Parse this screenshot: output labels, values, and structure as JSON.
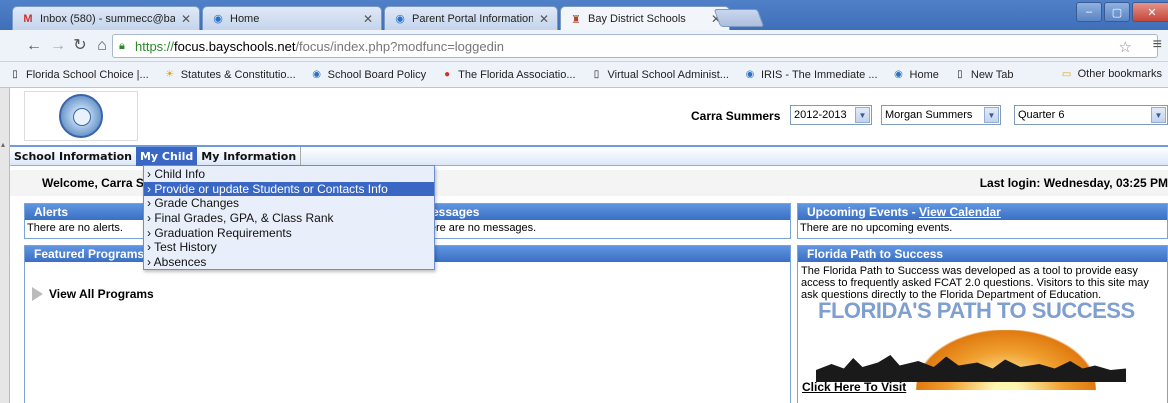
{
  "browser": {
    "tabs": [
      {
        "title": "Inbox (580) - summecc@bay",
        "favicon": "gmail-icon",
        "active": false
      },
      {
        "title": "Home",
        "favicon": "globe-icon",
        "active": false
      },
      {
        "title": "Parent Portal Information",
        "favicon": "globe-icon",
        "active": false
      },
      {
        "title": "Bay District Schools",
        "favicon": "school-icon",
        "active": true
      }
    ],
    "url": {
      "scheme": "https://",
      "host": "focus.bayschools.net",
      "path": "/focus/index.php?modfunc=loggedin"
    },
    "bookmarks": [
      {
        "label": "Florida School Choice |...",
        "icon": "page-icon"
      },
      {
        "label": "Statutes & Constitutio...",
        "icon": "sun-icon"
      },
      {
        "label": "School Board Policy",
        "icon": "globe-icon"
      },
      {
        "label": "The Florida Associatio...",
        "icon": "circle-icon"
      },
      {
        "label": "Virtual School Administ...",
        "icon": "page-icon"
      },
      {
        "label": "IRIS - The Immediate ...",
        "icon": "globe-icon"
      },
      {
        "label": "Home",
        "icon": "globe-icon"
      },
      {
        "label": "New Tab",
        "icon": "page-icon"
      }
    ],
    "other_bookmarks": "Other bookmarks"
  },
  "header": {
    "user_name": "Carra Summers",
    "year_select": "2012-2013",
    "student_select": "Morgan Summers",
    "quarter_select": "Quarter 6"
  },
  "menu": {
    "items": [
      "School Information",
      "My Child",
      "My Information"
    ],
    "active_index": 1
  },
  "dropdown": {
    "items": [
      "› Child Info",
      "› Provide or update Students or Contacts Info",
      "› Grade Changes",
      "› Final Grades, GPA, & Class Rank",
      "› Graduation Requirements",
      "› Test History",
      "› Absences"
    ],
    "highlighted_index": 1
  },
  "welcome": {
    "text": "Welcome, Carra S",
    "last_login": "Last login: Wednesday, 03:25 PM"
  },
  "panels": {
    "alerts": {
      "title": "Alerts",
      "body": "There are no alerts."
    },
    "messages": {
      "title": "Messages",
      "body": "There are no messages."
    },
    "events": {
      "title": "Upcoming Events - ",
      "link": "View Calendar",
      "body": "There are no upcoming events."
    },
    "featured": {
      "title": "Featured Programs",
      "view_all": "View All Programs"
    },
    "florida_path": {
      "title": "Florida Path to Success",
      "body": "The Florida Path to Success was developed as a tool to provide easy access to frequently asked FCAT 2.0 questions. Visitors to this site may ask questions directly to the Florida Department of Education.",
      "banner_text": "FLORIDA'S PATH TO SUCCESS",
      "link": "Click Here To Visit"
    }
  },
  "colors": {
    "menu_active": "#3a67c4",
    "panel_header": "#3a6fc4",
    "tabstrip": "#3e6fb8"
  }
}
